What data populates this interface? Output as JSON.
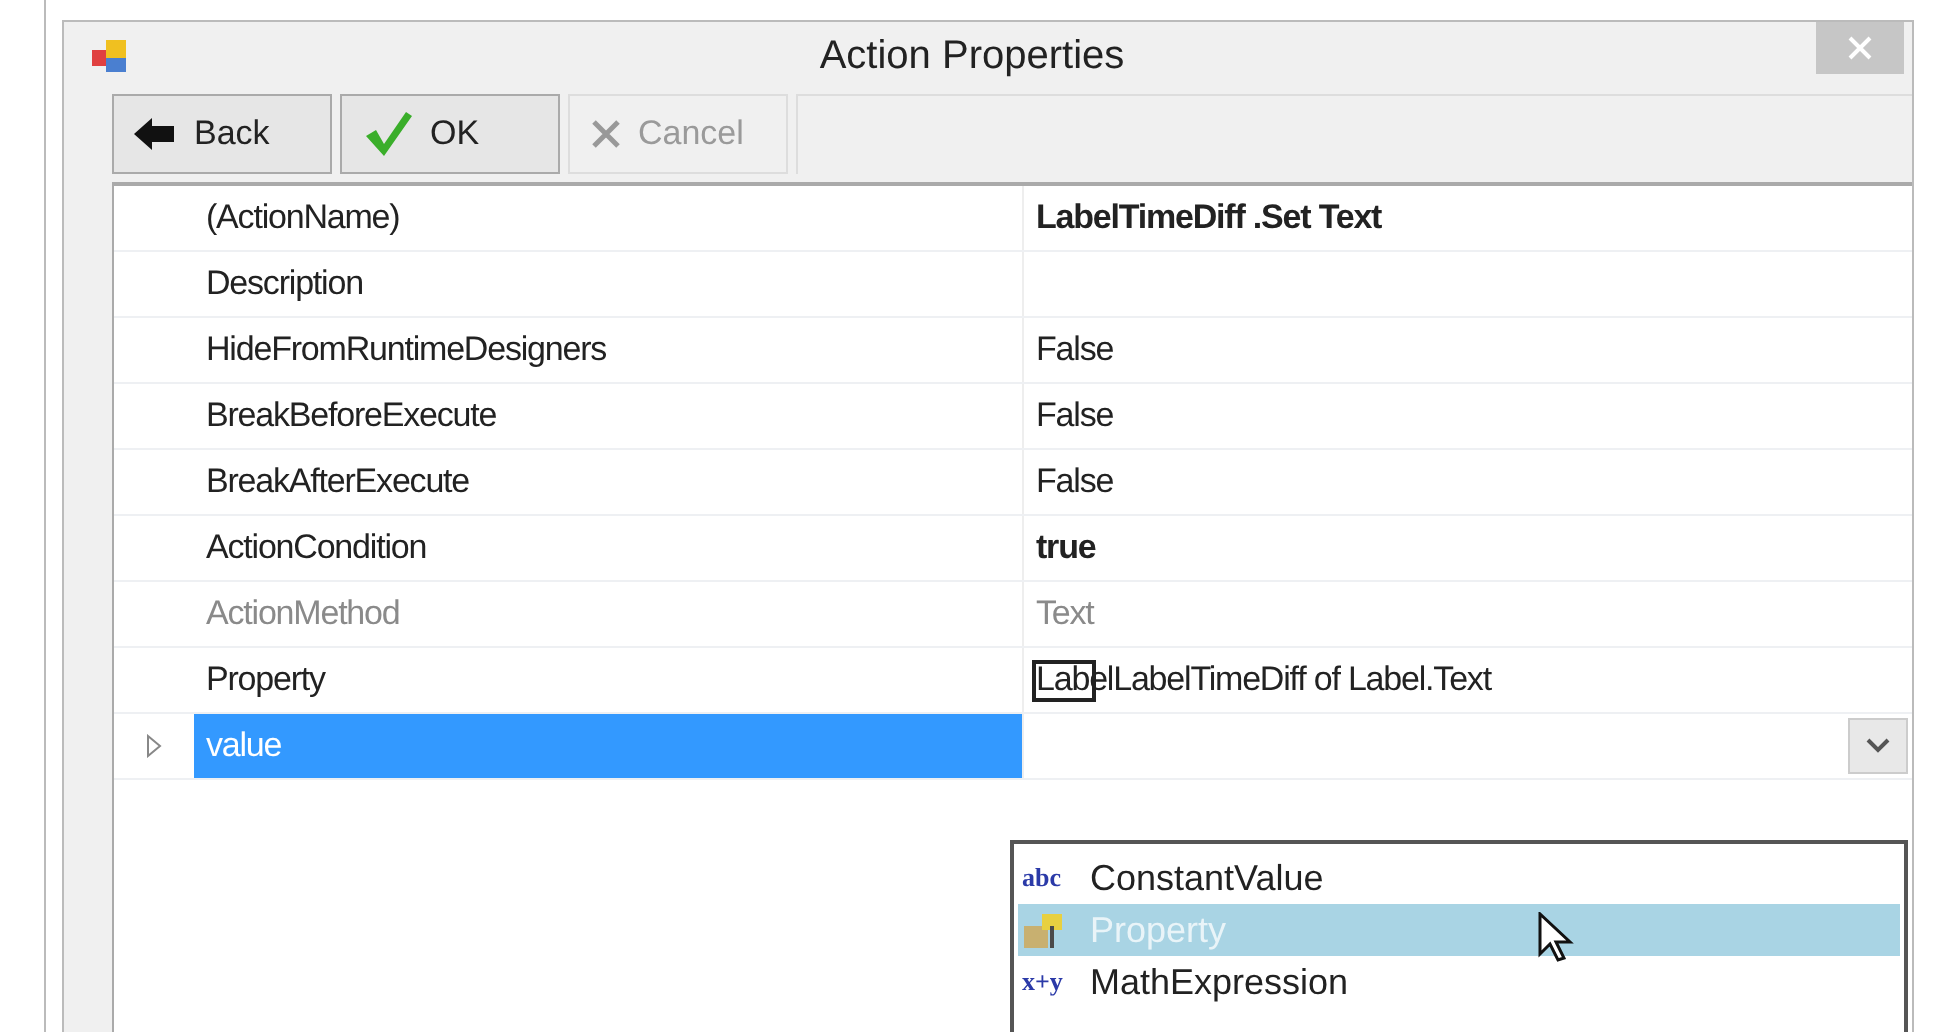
{
  "window": {
    "title": "Action Properties"
  },
  "toolbar": [
    {
      "label": "Back",
      "kind": "back",
      "disabled": false
    },
    {
      "label": "OK",
      "kind": "ok",
      "disabled": false
    },
    {
      "label": "Cancel",
      "kind": "cancel",
      "disabled": true
    }
  ],
  "properties": [
    {
      "name": "(ActionName)",
      "value": "LabelTimeDiff .Set Text",
      "bold": true,
      "disabled": false,
      "selected": false,
      "expandable": false
    },
    {
      "name": "Description",
      "disabled": false,
      "selected": false,
      "expandable": false
    },
    {
      "name": "HideFromRuntimeDesigners",
      "value": "False",
      "bold": false,
      "disabled": false,
      "selected": false,
      "expandable": false
    },
    {
      "name": "BreakBeforeExecute",
      "value": "False",
      "bold": false,
      "disabled": false,
      "selected": false,
      "expandable": false
    },
    {
      "name": "BreakAfterExecute",
      "value": "False",
      "bold": false,
      "disabled": false,
      "selected": false,
      "expandable": false
    },
    {
      "name": "ActionCondition",
      "value": "true",
      "bold": true,
      "disabled": false,
      "selected": false,
      "expandable": false
    },
    {
      "name": "ActionMethod",
      "value": "Text",
      "bold": false,
      "disabled": true,
      "selected": false,
      "expandable": false
    },
    {
      "name": "Property",
      "value": "LabelLabelTimeDiff of Label.Text",
      "bold": false,
      "disabled": false,
      "selected": false,
      "expandable": false
    },
    {
      "name": "value",
      "disabled": false,
      "selected": true,
      "expandable": true,
      "dropdown": true
    }
  ],
  "dropdown_options": [
    {
      "glyph": "abc",
      "label": "ConstantValue",
      "kind": "text",
      "selected": false
    },
    {
      "label": "Property",
      "kind": "property",
      "selected": true
    },
    {
      "glyph": "x+y",
      "label": "MathExpression",
      "kind": "text",
      "selected": false
    }
  ]
}
